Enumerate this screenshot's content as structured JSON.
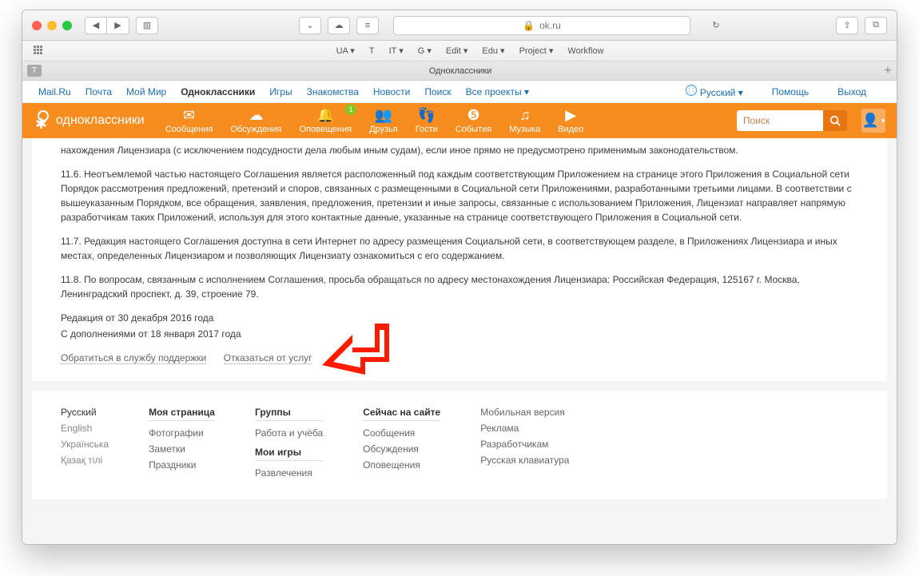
{
  "browser": {
    "url_host": "ok.ru",
    "bookmarks": [
      "UA ▾",
      "T",
      "IT ▾",
      "G ▾",
      "Edit ▾",
      "Edu ▾",
      "Project ▾",
      "Workflow"
    ],
    "tab_title": "Одноклассники"
  },
  "mailnav": {
    "items": [
      "Mail.Ru",
      "Почта",
      "Мой Мир",
      "Одноклассники",
      "Игры",
      "Знакомства",
      "Новости",
      "Поиск",
      "Все проекты ▾"
    ],
    "active_index": 3,
    "lang": "Русский ▾",
    "help": "Помощь",
    "exit": "Выход"
  },
  "okbar": {
    "brand": "одноклассники",
    "items": [
      {
        "label": "Сообщения",
        "icon": "✉"
      },
      {
        "label": "Обсуждения",
        "icon": "☁"
      },
      {
        "label": "Оповещения",
        "icon": "🔔",
        "badge": "1"
      },
      {
        "label": "Друзья",
        "icon": "👥"
      },
      {
        "label": "Гости",
        "icon": "👣"
      },
      {
        "label": "События",
        "icon": "❺"
      },
      {
        "label": "Музыка",
        "icon": "♫"
      },
      {
        "label": "Видео",
        "icon": "▶"
      }
    ],
    "search_placeholder": "Поиск"
  },
  "doc": {
    "p0": "нахождения Лицензиара (с исключением подсудности дела любым иным судам), если иное прямо не предусмотрено применимым законодательством.",
    "p1": "11.6. Неотъемлемой частью настоящего Соглашения является расположенный под каждым соответствующим Приложением на странице этого Приложения в Социальной сети Порядок рассмотрения предложений, претензий и споров, связанных с размещенными в Социальной сети Приложениями, разработанными третьими лицами. В соответствии с вышеуказанным Порядком, все обращения, заявления, предложения, претензии и иные запросы, связанные с использованием Приложения, Лицензиат направляет напрямую разработчикам таких Приложений, используя для этого контактные данные, указанные на странице соответствующего Приложения в Социальной сети.",
    "p2": "11.7. Редакция настоящего Соглашения доступна в сети Интернет по адресу размещения Социальной сети, в соответствующем разделе, в Приложениях Лицензиара и иных местах, определенных Лицензиаром и позволяющих Лицензиату ознакомиться с его содержанием.",
    "p3": "11.8. По вопросам, связанным с исполнением Соглашения, просьба обращаться по адресу местонахождения Лицензиара: Российская Федерация, 125167 г. Москва, Ленинградский проспект, д. 39, строение 79.",
    "rev1": "Редакция от 30 декабря 2016 года",
    "rev2": "С дополнениями от 18 января 2017 года",
    "link_support": "Обратиться в службу поддержки",
    "link_refuse": "Отказаться от услуг"
  },
  "footer": {
    "langs": [
      "Русский",
      "English",
      "Українська",
      "Қазақ тілі"
    ],
    "c1_h": "Моя страница",
    "c1": [
      "Фотографии",
      "Заметки",
      "Праздники"
    ],
    "c2_h": "Группы",
    "c2a": [
      "Работа и учёба"
    ],
    "c2b_h": "Мои игры",
    "c2b": [
      "Развлечения"
    ],
    "c3_h": "Сейчас на сайте",
    "c3": [
      "Сообщения",
      "Обсуждения",
      "Оповещения"
    ],
    "c4": [
      "Мобильная версия",
      "Реклама",
      "Разработчикам",
      "Русская клавиатура"
    ]
  }
}
